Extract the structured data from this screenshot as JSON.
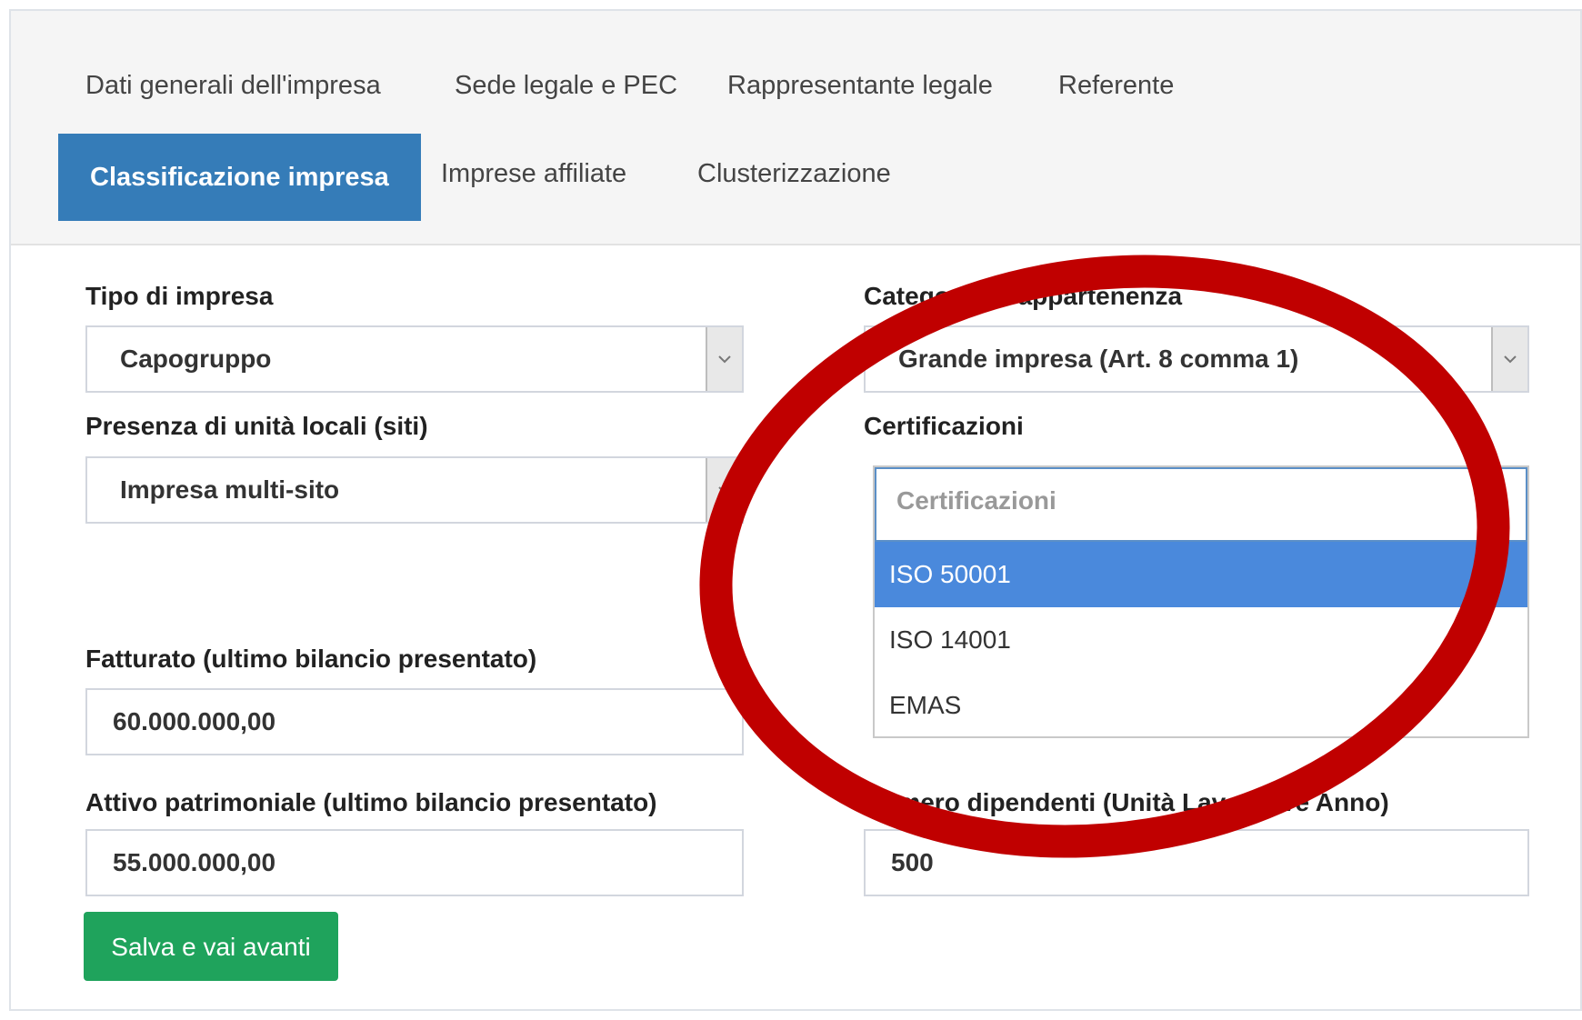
{
  "tabs": [
    {
      "label": "Dati generali dell'impresa"
    },
    {
      "label": "Sede legale e PEC"
    },
    {
      "label": "Rappresentante legale"
    },
    {
      "label": "Referente"
    },
    {
      "label": "Classificazione impresa",
      "active": true
    },
    {
      "label": "Imprese affiliate"
    },
    {
      "label": "Clusterizzazione"
    }
  ],
  "form": {
    "tipo": {
      "label": "Tipo di impresa",
      "value": "Capogruppo"
    },
    "categoria": {
      "label": "Categoria di appartenenza",
      "value": "Grande impresa (Art. 8 comma 1)"
    },
    "presenza": {
      "label": "Presenza di unità locali (siti)",
      "value": "Impresa multi-sito"
    },
    "certificazioni": {
      "label": "Certificazioni",
      "placeholder": "Certificazioni",
      "options": [
        "ISO 50001",
        "ISO 14001",
        "EMAS"
      ],
      "highlighted": "ISO 50001"
    },
    "fatturato": {
      "label": "Fatturato (ultimo bilancio presentato)",
      "value": "60.000.000,00"
    },
    "attivo": {
      "label": "Attivo patrimoniale (ultimo bilancio presentato)",
      "value": "55.000.000,00"
    },
    "dipendenti": {
      "label": "Numero dipendenti (Unità Lavorative Anno)",
      "value": "500"
    }
  },
  "actions": {
    "save_label": "Salva e vai avanti"
  },
  "colors": {
    "active_tab": "#357cb8",
    "highlight_option": "#4a89dc",
    "save_button": "#1fa35c",
    "annotation_circle": "#c00000"
  }
}
